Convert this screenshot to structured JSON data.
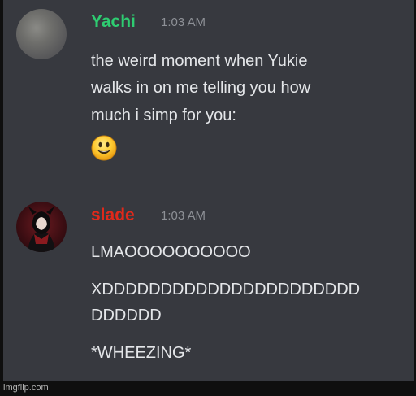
{
  "messages": [
    {
      "author": "Yachi",
      "author_color": "#2ecc71",
      "timestamp": "1:03 AM",
      "lines": [
        "the weird moment when Yukie",
        "walks in on me telling you how",
        "much i simp for you:"
      ],
      "emoji": "smiley-emoji"
    },
    {
      "author": "slade",
      "author_color": "#e0291b",
      "timestamp": "1:03 AM",
      "lines": [
        "LMAOOOOOOOOOO",
        "XDDDDDDDDDDDDDDDDDDDDDD",
        "DDDDDD",
        "*WHEEZING*"
      ]
    }
  ],
  "watermark": "imgflip.com"
}
